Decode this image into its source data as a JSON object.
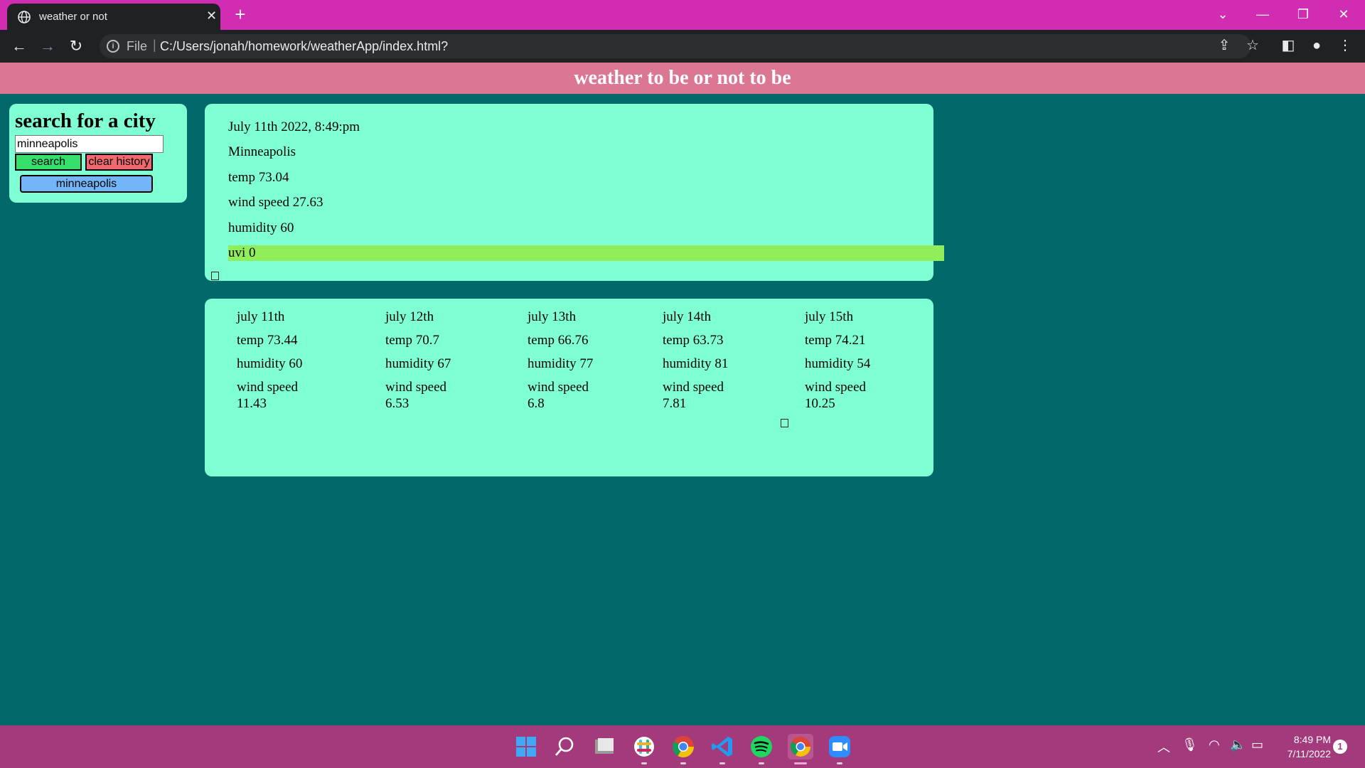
{
  "browser": {
    "tab_title": "weather or not",
    "tab_close": "✕",
    "new_tab": "+",
    "address_scheme": "File",
    "address_separator": "|",
    "url": "C:/Users/jonah/homework/weatherApp/index.html?"
  },
  "page": {
    "header_title": "weather to be or not to be"
  },
  "search": {
    "heading": "search for a city",
    "input_value": "minneapolis",
    "search_label": "search",
    "clear_label": "clear history",
    "history": [
      "minneapolis"
    ]
  },
  "current": {
    "date": "July 11th 2022, 8:49:pm",
    "city": "Minneapolis",
    "temp": "temp 73.04",
    "wind": "wind speed 27.63",
    "humidity": "humidity 60",
    "uvi": "uvi 0",
    "uvi_color": "#90ee5a"
  },
  "forecast": [
    {
      "date": "july 11th",
      "temp": "temp 73.44",
      "humidity": "humidity 60",
      "wind_label": "wind speed",
      "wind_value": "11.43"
    },
    {
      "date": "july 12th",
      "temp": "temp 70.7",
      "humidity": "humidity 67",
      "wind_label": "wind speed",
      "wind_value": "6.53"
    },
    {
      "date": "july 13th",
      "temp": "temp 66.76",
      "humidity": "humidity 77",
      "wind_label": "wind speed",
      "wind_value": "6.8"
    },
    {
      "date": "july 14th",
      "temp": "temp 63.73",
      "humidity": "humidity 81",
      "wind_label": "wind speed",
      "wind_value": "7.81"
    },
    {
      "date": "july 15th",
      "temp": "temp 74.21",
      "humidity": "humidity 54",
      "wind_label": "wind speed",
      "wind_value": "10.25"
    }
  ],
  "taskbar": {
    "time": "8:49 PM",
    "date": "7/11/2022",
    "notification_count": "1",
    "apps": [
      "windows-start",
      "search",
      "file-explorer",
      "slack",
      "chrome",
      "vscode",
      "spotify",
      "chrome-active",
      "zoom"
    ]
  },
  "colors": {
    "tab_bar": "#d02db2",
    "header": "#db7793",
    "page_bg": "#02686a",
    "panel": "#7fffd4",
    "search_button": "#36de6c",
    "clear_button": "#f0696f",
    "history_button": "#72b6f8",
    "taskbar": "#a33a7b"
  }
}
